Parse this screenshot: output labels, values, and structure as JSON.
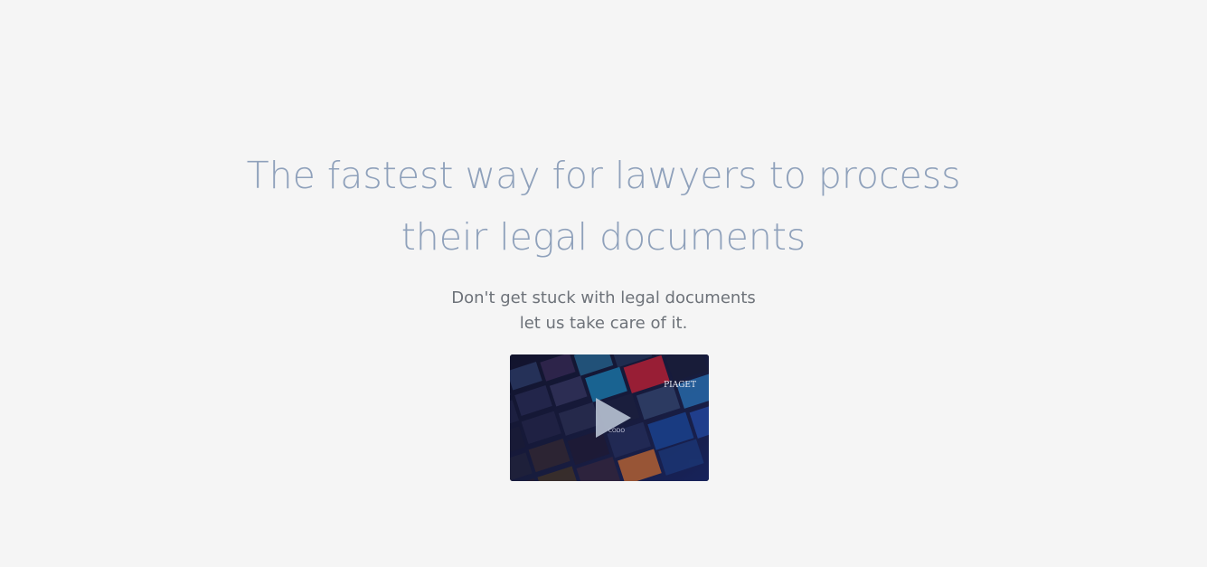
{
  "hero": {
    "headline_line1": "The fastest way for lawyers to process",
    "headline_line2": "their legal documents",
    "subtext_line1": "Don't get stuck with legal documents",
    "subtext_line2": "let us take care of it."
  },
  "video": {
    "thumbnail_icon": "play-icon",
    "thumbnail_text_1": "PIAGET",
    "thumbnail_text_2": "CODO"
  },
  "colors": {
    "background": "#f5f5f5",
    "headline": "#8fa1bb",
    "subtext": "#6d7279"
  }
}
